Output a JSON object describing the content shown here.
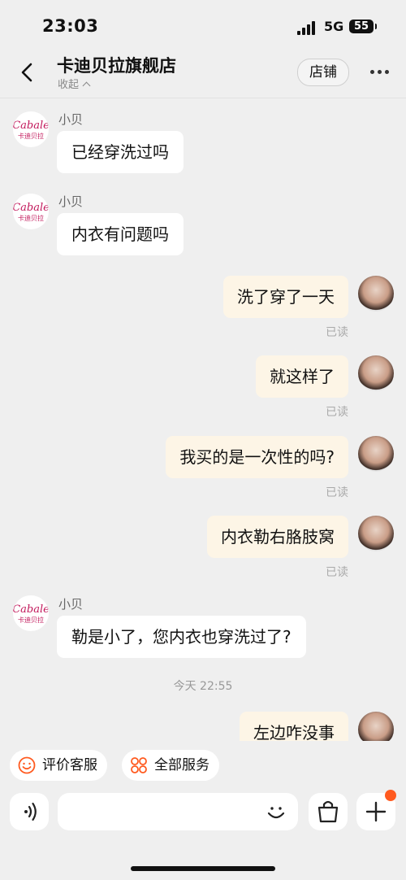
{
  "status": {
    "time": "23:03",
    "network": "5G",
    "battery": "55"
  },
  "header": {
    "title": "卡迪贝拉旗舰店",
    "collapse_label": "收起",
    "store_label": "店铺"
  },
  "shop_logo": {
    "line1": "Cabale",
    "line2": "卡迪贝拉"
  },
  "messages": [
    {
      "side": "in",
      "sender": "小贝",
      "text": "已经穿洗过吗"
    },
    {
      "side": "in",
      "sender": "小贝",
      "text": "内衣有问题吗"
    },
    {
      "side": "out",
      "text": "洗了穿了一天",
      "status": "已读"
    },
    {
      "side": "out",
      "text": "就这样了",
      "status": "已读"
    },
    {
      "side": "out",
      "text": "我买的是一次性的吗?",
      "status": "已读"
    },
    {
      "side": "out",
      "text": "内衣勒右胳肢窝",
      "status": "已读"
    },
    {
      "side": "in",
      "sender": "小贝",
      "text": "勒是小了，您内衣也穿洗过了?"
    },
    {
      "side": "out",
      "text": "左边咋没事"
    }
  ],
  "time_divider": "今天 22:55",
  "quick_actions": [
    {
      "label": "评价客服",
      "icon": "smile-icon"
    },
    {
      "label": "全部服务",
      "icon": "grid-flower-icon"
    }
  ],
  "input": {
    "value": "",
    "placeholder": ""
  },
  "colors": {
    "accent": "#ff5a1f",
    "out_bubble": "#fdf5e6",
    "logo": "#c2185b"
  }
}
